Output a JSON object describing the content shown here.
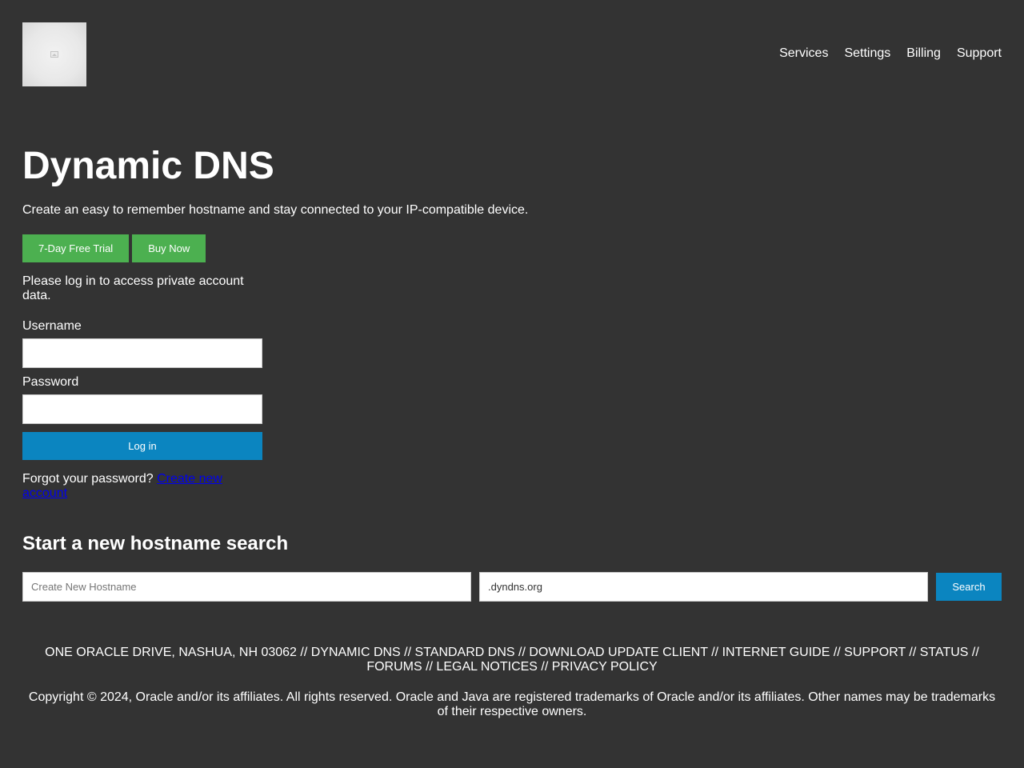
{
  "header": {
    "nav": [
      "Services",
      "Settings",
      "Billing",
      "Support"
    ]
  },
  "hero": {
    "title": "Dynamic DNS",
    "subtitle": "Create an easy to remember hostname and stay connected to your IP-compatible device.",
    "trial_label": "7-Day Free Trial",
    "buy_label": "Buy Now"
  },
  "login": {
    "note": "Please log in to access private account data.",
    "username_label": "Username",
    "username_value": "",
    "password_label": "Password",
    "password_value": "",
    "submit_label": "Log in",
    "forgot_text": "Forgot your password?",
    "create_account_label": "Create new account"
  },
  "search": {
    "heading": "Start a new hostname search",
    "hostname_placeholder": "Create New Hostname",
    "hostname_value": "",
    "domain_value": ".dyndns.org",
    "button_label": "Search"
  },
  "footer": {
    "links": [
      "ONE ORACLE DRIVE, NASHUA, NH 03062",
      "DYNAMIC DNS",
      "STANDARD DNS",
      "DOWNLOAD UPDATE CLIENT",
      "INTERNET GUIDE",
      "SUPPORT",
      "STATUS",
      "FORUMS",
      "LEGAL NOTICES",
      "PRIVACY POLICY"
    ],
    "separator": " // ",
    "copyright": "Copyright © 2024, Oracle and/or its affiliates. All rights reserved. Oracle and Java are registered trademarks of Oracle and/or its affiliates. Other names may be trademarks of their respective owners."
  },
  "colors": {
    "background": "#333333",
    "green_button": "#4cb050",
    "blue_button": "#0b85c0",
    "link": "#0000ee"
  }
}
